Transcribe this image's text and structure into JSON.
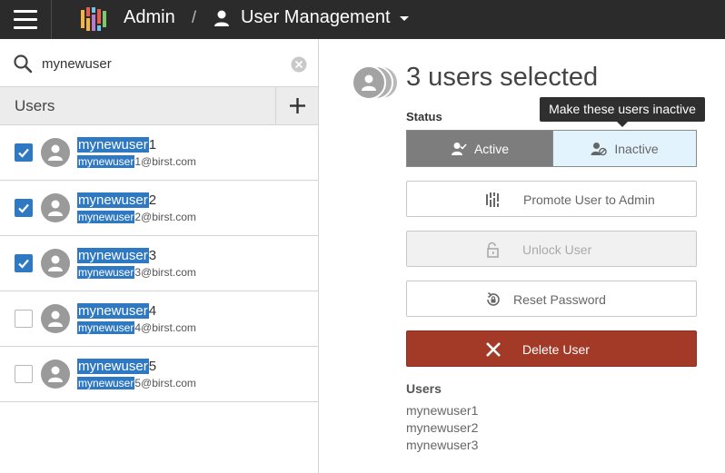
{
  "topbar": {
    "app_name": "Admin",
    "separator": "/",
    "section_title": "User Management"
  },
  "search": {
    "value": "mynewuser",
    "placeholder": ""
  },
  "user_list": {
    "header_label": "Users",
    "users": [
      {
        "name_match": "mynewuser",
        "name_rest": "1",
        "email_match": "mynewuser",
        "email_rest": "1@birst.com",
        "checked": true
      },
      {
        "name_match": "mynewuser",
        "name_rest": "2",
        "email_match": "mynewuser",
        "email_rest": "2@birst.com",
        "checked": true
      },
      {
        "name_match": "mynewuser",
        "name_rest": "3",
        "email_match": "mynewuser",
        "email_rest": "3@birst.com",
        "checked": true
      },
      {
        "name_match": "mynewuser",
        "name_rest": "4",
        "email_match": "mynewuser",
        "email_rest": "4@birst.com",
        "checked": false
      },
      {
        "name_match": "mynewuser",
        "name_rest": "5",
        "email_match": "mynewuser",
        "email_rest": "5@birst.com",
        "checked": false
      }
    ]
  },
  "details": {
    "selection_title": "3 users selected",
    "tooltip": "Make these users inactive",
    "status_label": "Status",
    "status_active": "Active",
    "status_inactive": "Inactive",
    "promote_label": "Promote User to Admin",
    "unlock_label": "Unlock User",
    "reset_label": "Reset Password",
    "delete_label": "Delete User",
    "users_heading": "Users",
    "selected_users": [
      "mynewuser1",
      "mynewuser2",
      "mynewuser3"
    ]
  },
  "colors": {
    "topbar_bg": "#2b2b2b",
    "accent": "#2f79c2",
    "danger": "#a33a28",
    "active_toggle": "#7d7d7d",
    "inactive_toggle": "#e3f3fd"
  },
  "icons": {
    "menu": "hamburger-icon",
    "logo": "birst-logo-icon",
    "user": "user-icon",
    "search": "search-icon",
    "clear": "clear-icon",
    "add": "plus-icon",
    "active": "user-check-icon",
    "inactive": "user-block-icon",
    "promote": "birst-logo-icon",
    "unlock": "unlock-icon",
    "reset": "reset-password-icon",
    "delete": "close-icon"
  }
}
